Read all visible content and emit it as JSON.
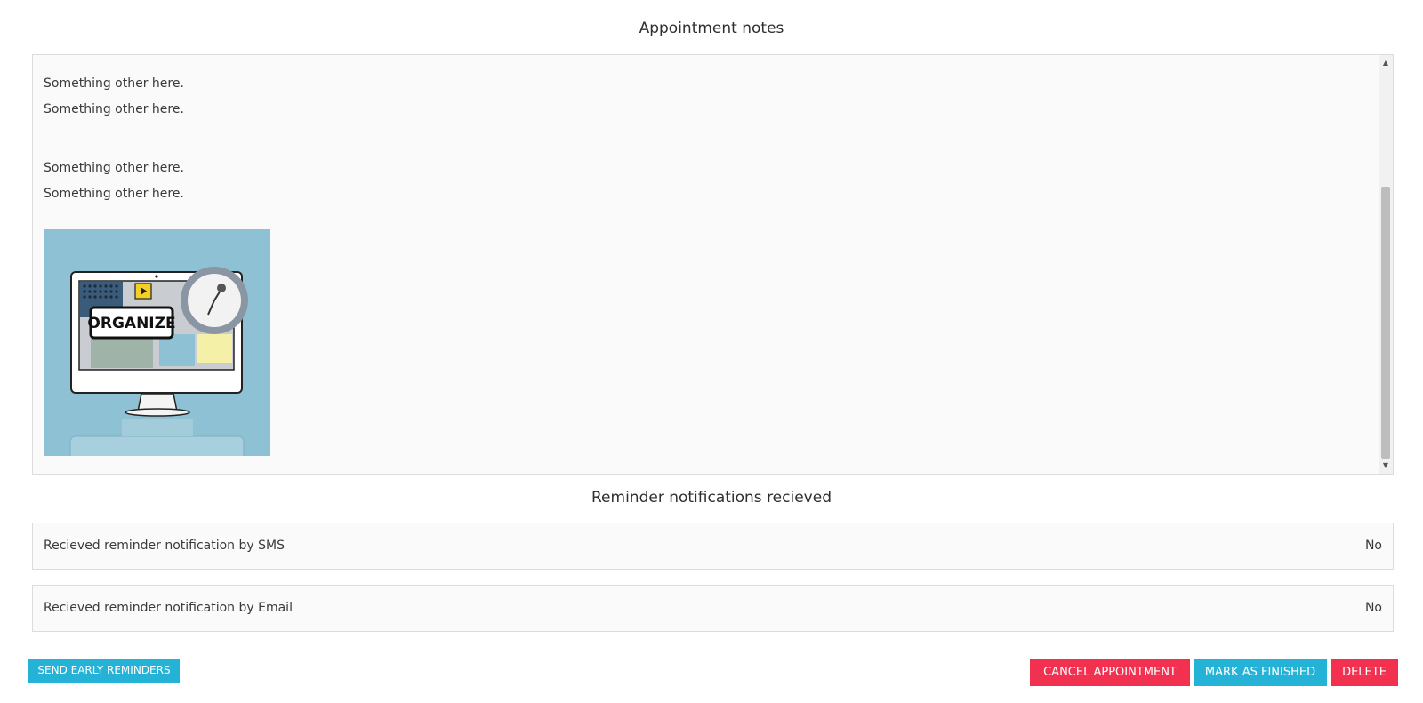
{
  "notes": {
    "title": "Appointment notes",
    "lines_group1": [
      "Something other here.",
      "Something other here."
    ],
    "lines_group2": [
      "Something other here.",
      "Something other here."
    ],
    "image": {
      "caption": "ORGANIZE",
      "icon": "organize-monitor-illustration"
    }
  },
  "reminders": {
    "title": "Reminder notifications recieved",
    "rows": [
      {
        "label": "Recieved reminder notification by SMS",
        "value": "No"
      },
      {
        "label": "Recieved reminder notification by Email",
        "value": "No"
      }
    ]
  },
  "actions": {
    "send_early": "SEND EARLY REMINDERS",
    "cancel": "CANCEL APPOINTMENT",
    "finish": "MARK AS FINISHED",
    "delete": "DELETE"
  },
  "colors": {
    "primary_blue": "#24b3d7",
    "danger_red": "#f2304f",
    "panel_bg": "#fafafa"
  }
}
